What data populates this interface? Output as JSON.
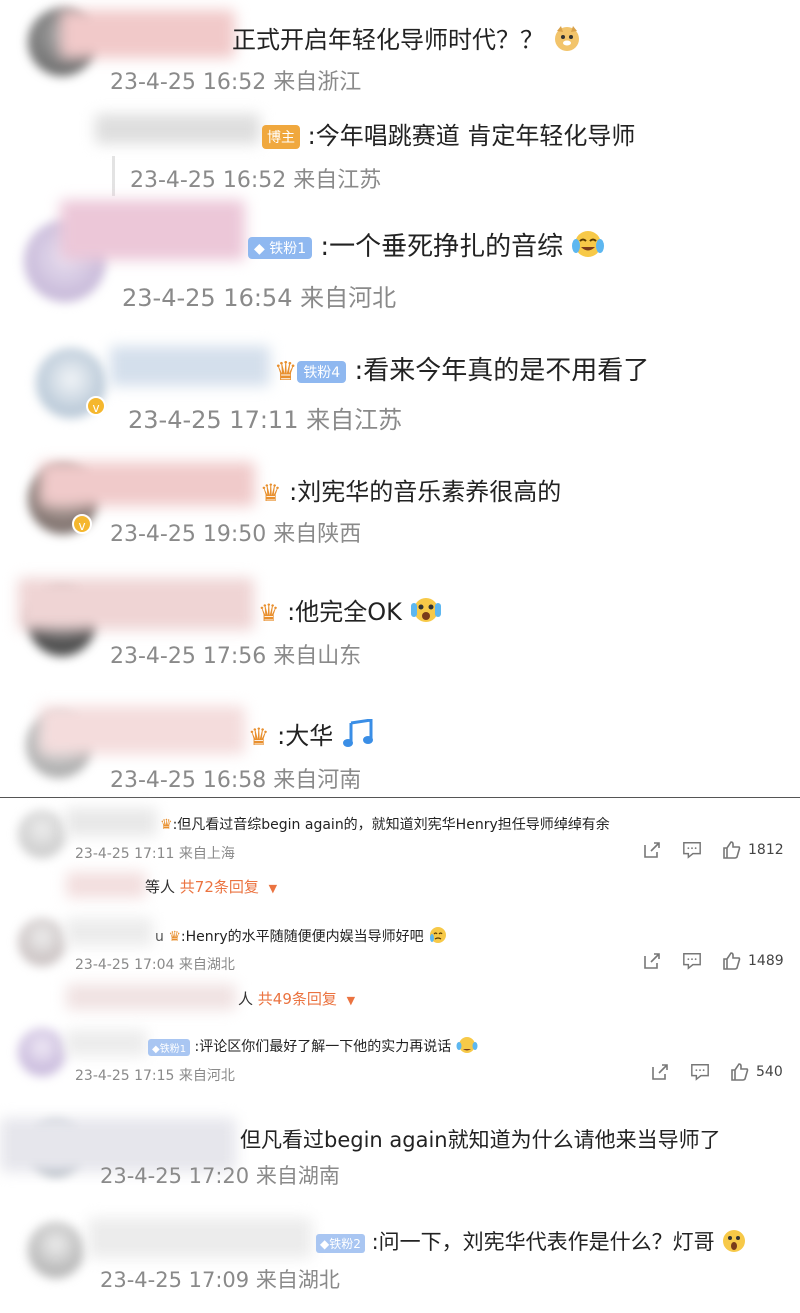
{
  "top_comments": [
    {
      "text": "正式开启年轻化导师时代？？",
      "emoji_icon": "doge-emoji-icon",
      "time": "23-4-25 16:52",
      "location": "来自浙江",
      "avatar_color": "#6f6f6f",
      "name_color": "#f1c9c9"
    },
    {
      "badge": "博主",
      "text": ":今年唱跳赛道 肯定年轻化导师",
      "time": "23-4-25 16:52",
      "location": "来自江苏",
      "name_color": "#d7d7d7"
    },
    {
      "badge": "铁粉1",
      "text": ":一个垂死挣扎的音综",
      "emoji_icon": "cry-laugh-emoji-icon",
      "time": "23-4-25 16:54",
      "location": "来自河北",
      "avatar_color": "#cbbcdd",
      "name_color": "#e9c1d4"
    },
    {
      "badge": "铁粉4",
      "text": ":看来今年真的是不用看了",
      "time": "23-4-25 17:11",
      "location": "来自江苏",
      "avatar_color": "#c2d1e0",
      "name_color": "#d1dceb"
    },
    {
      "text": ":刘宪华的音乐素养很高的",
      "time": "23-4-25 19:50",
      "location": "来自陕西",
      "avatar_color": "#8a7b78",
      "name_color": "#f0c7c7"
    },
    {
      "text": ":他完全OK",
      "emoji_icon": "shocked-emoji-icon",
      "time": "23-4-25 17:56",
      "location": "来自山东",
      "avatar_color": "#4b4b4b",
      "name_color": "#f2d6d6"
    },
    {
      "text": ":大华",
      "emoji_icon": "music-note-icon",
      "time": "23-4-25 16:58",
      "location": "来自河南",
      "avatar_color": "#bdbdbd",
      "name_color": "#f5dada"
    }
  ],
  "bottom_comments": [
    {
      "text": ":但凡看过音综begin again的，就知道刘宪华Henry担任导师绰绰有余",
      "time": "23-4-25 17:11",
      "location": "来自上海",
      "likes": "1812",
      "reply_prefix": "等人",
      "reply_count": "共72条回复",
      "avatar_color": "#d6d6d6"
    },
    {
      "name_partial": "u",
      "text": ":Henry的水平随随便便内娱当导师好吧",
      "time": "23-4-25 17:04",
      "location": "来自湖北",
      "likes": "1489",
      "reply_prefix": "人",
      "reply_count": "共49条回复",
      "avatar_color": "#d0c8c8"
    },
    {
      "badge": "铁粉1",
      "text": ":评论区你们最好了解一下他的实力再说话",
      "time": "23-4-25 17:15",
      "location": "来自河北",
      "likes": "540",
      "avatar_color": "#c8b8d8"
    }
  ],
  "tail_comments": [
    {
      "text": "但凡看过begin again就知道为什么请他来当导师了",
      "time": "23-4-25 17:20",
      "location": "来自湖南",
      "avatar_color": "#9aa3ad"
    },
    {
      "badge": "铁粉2",
      "text": ":问一下，刘宪华代表作是什么？灯哥",
      "time": "23-4-25 17:09",
      "location": "来自湖北",
      "avatar_color": "#b5b5b5"
    }
  ],
  "icons": {
    "share": "share-icon",
    "comment": "comment-icon",
    "like": "thumbs-up-icon",
    "reply_expand": "caret-down-icon",
    "verified": "verified-v-icon",
    "crown": "crown-fan-icon"
  },
  "colors": {
    "text": "#222222",
    "meta": "#8a8a8a",
    "reply_accent": "#eb7340",
    "host_badge": "#f0a83e",
    "fan_badge": "#8fb8f0",
    "verified": "#f5b72e"
  }
}
